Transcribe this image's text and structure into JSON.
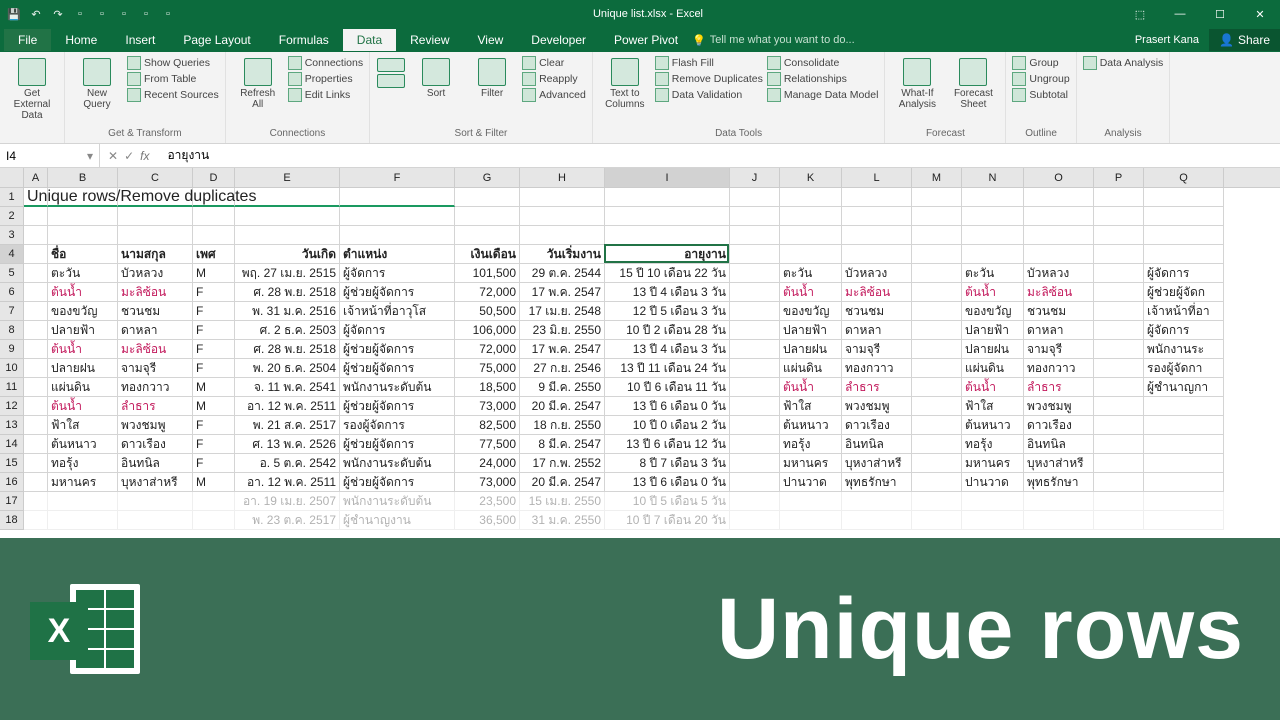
{
  "titlebar": {
    "title": "Unique list.xlsx - Excel"
  },
  "user": "Prasert Kana",
  "share": "Share",
  "tabs": {
    "file": "File",
    "home": "Home",
    "insert": "Insert",
    "pagelayout": "Page Layout",
    "formulas": "Formulas",
    "data": "Data",
    "review": "Review",
    "view": "View",
    "developer": "Developer",
    "powerpivot": "Power Pivot"
  },
  "tell": "Tell me what you want to do...",
  "ribbon": {
    "getexternal": "Get External\nData",
    "newquery": "New\nQuery",
    "refreshall": "Refresh\nAll",
    "sort": "Sort",
    "filter": "Filter",
    "texttocolumns": "Text to\nColumns",
    "whatif": "What-If\nAnalysis",
    "forecast": "Forecast\nSheet",
    "showqueries": "Show Queries",
    "fromtable": "From Table",
    "recentsources": "Recent Sources",
    "connections": "Connections",
    "properties": "Properties",
    "editlinks": "Edit Links",
    "clear": "Clear",
    "reapply": "Reapply",
    "advanced": "Advanced",
    "flashfill": "Flash Fill",
    "removedup": "Remove Duplicates",
    "datavalidation": "Data Validation",
    "consolidate": "Consolidate",
    "relationships": "Relationships",
    "managedata": "Manage Data Model",
    "groupbtn": "Group",
    "ungroup": "Ungroup",
    "subtotal": "Subtotal",
    "dataanalysis": "Data Analysis",
    "groups": {
      "gettransform": "Get & Transform",
      "connections": "Connections",
      "sortfilter": "Sort & Filter",
      "datatools": "Data Tools",
      "forecast": "Forecast",
      "outline": "Outline",
      "analysis": "Analysis"
    }
  },
  "namebox": "I4",
  "formula": "อายุงาน",
  "columns": [
    "A",
    "B",
    "C",
    "D",
    "E",
    "F",
    "G",
    "H",
    "I",
    "J",
    "K",
    "L",
    "M",
    "N",
    "O",
    "P",
    "Q"
  ],
  "title_cell": "Unique rows/Remove duplicates",
  "headers": {
    "name": "ชื่อ",
    "surname": "นามสกุล",
    "gender": "เพศ",
    "birth": "วันเกิด",
    "position": "ตำแหน่ง",
    "salary": "เงินเดือน",
    "startdate": "วันเริ่มงาน",
    "tenure": "อายุงาน"
  },
  "rows": [
    {
      "n": "ตะวัน",
      "s": "บัวหลวง",
      "g": "M",
      "b": "พฤ. 27 เม.ย. 2515",
      "p": "ผู้จัดการ",
      "sal": "101,500",
      "sd": "29 ต.ค. 2544",
      "t": "15 ปี 10 เดือน 22 วัน",
      "k": "ตะวัน",
      "l": "บัวหลวง",
      "nn": "ตะวัน",
      "oo": "บัวหลวง",
      "q": "ผู้จัดการ"
    },
    {
      "n": "ต้นน้ำ",
      "s": "มะลิซ้อน",
      "g": "F",
      "b": "ศ. 28 พ.ย. 2518",
      "p": "ผู้ช่วยผู้จัดการ",
      "sal": "72,000",
      "sd": "17 พ.ค. 2547",
      "t": "13 ปี 4 เดือน 3 วัน",
      "k": "ต้นน้ำ",
      "l": "มะลิซ้อน",
      "nn": "ต้นน้ำ",
      "oo": "มะลิซ้อน",
      "q": "ผู้ช่วยผู้จัดก",
      "pink": true,
      "kpink": true,
      "npink": true
    },
    {
      "n": "ของขวัญ",
      "s": "ชวนชม",
      "g": "F",
      "b": "พ. 31 ม.ค. 2516",
      "p": "เจ้าหน้าที่อาวุโส",
      "sal": "50,500",
      "sd": "17 เม.ย. 2548",
      "t": "12 ปี 5 เดือน 3 วัน",
      "k": "ของขวัญ",
      "l": "ชวนชม",
      "nn": "ของขวัญ",
      "oo": "ชวนชม",
      "q": "เจ้าหน้าที่อา"
    },
    {
      "n": "ปลายฟ้า",
      "s": "ดาหลา",
      "g": "F",
      "b": "ศ. 2 ธ.ค. 2503",
      "p": "ผู้จัดการ",
      "sal": "106,000",
      "sd": "23 มิ.ย. 2550",
      "t": "10 ปี 2 เดือน 28 วัน",
      "k": "ปลายฟ้า",
      "l": "ดาหลา",
      "nn": "ปลายฟ้า",
      "oo": "ดาหลา",
      "q": "ผู้จัดการ"
    },
    {
      "n": "ต้นน้ำ",
      "s": "มะลิซ้อน",
      "g": "F",
      "b": "ศ. 28 พ.ย. 2518",
      "p": "ผู้ช่วยผู้จัดการ",
      "sal": "72,000",
      "sd": "17 พ.ค. 2547",
      "t": "13 ปี 4 เดือน 3 วัน",
      "k": "ปลายฝน",
      "l": "จามจุรี",
      "nn": "ปลายฝน",
      "oo": "จามจุรี",
      "q": "พนักงานระ",
      "pink": true
    },
    {
      "n": "ปลายฝน",
      "s": "จามจุรี",
      "g": "F",
      "b": "พ. 20 ธ.ค. 2504",
      "p": "ผู้ช่วยผู้จัดการ",
      "sal": "75,000",
      "sd": "27 ก.ย. 2546",
      "t": "13 ปี 11 เดือน 24 วัน",
      "k": "แผ่นดิน",
      "l": "ทองกวาว",
      "nn": "แผ่นดิน",
      "oo": "ทองกวาว",
      "q": "รองผู้จัดกา"
    },
    {
      "n": "แผ่นดิน",
      "s": "ทองกวาว",
      "g": "M",
      "b": "จ. 11 พ.ค. 2541",
      "p": "พนักงานระดับต้น",
      "sal": "18,500",
      "sd": "9 มี.ค. 2550",
      "t": "10 ปี 6 เดือน 11 วัน",
      "k": "ต้นน้ำ",
      "l": "ลำธาร",
      "nn": "ต้นน้ำ",
      "oo": "ลำธาร",
      "q": "ผู้ชำนาญกา",
      "kpink": true,
      "npink": true
    },
    {
      "n": "ต้นน้ำ",
      "s": "ลำธาร",
      "g": "M",
      "b": "อา. 12 พ.ค. 2511",
      "p": "ผู้ช่วยผู้จัดการ",
      "sal": "73,000",
      "sd": "20 มี.ค. 2547",
      "t": "13 ปี 6 เดือน 0 วัน",
      "k": "ฟ้าใส",
      "l": "พวงชมพู",
      "nn": "ฟ้าใส",
      "oo": "พวงชมพู",
      "pink": true
    },
    {
      "n": "ฟ้าใส",
      "s": "พวงชมพู",
      "g": "F",
      "b": "พ. 21 ส.ค. 2517",
      "p": "รองผู้จัดการ",
      "sal": "82,500",
      "sd": "18 ก.ย. 2550",
      "t": "10 ปี 0 เดือน 2 วัน",
      "k": "ต้นหนาว",
      "l": "ดาวเรือง",
      "nn": "ต้นหนาว",
      "oo": "ดาวเรือง"
    },
    {
      "n": "ต้นหนาว",
      "s": "ดาวเรือง",
      "g": "F",
      "b": "ศ. 13 พ.ค. 2526",
      "p": "ผู้ช่วยผู้จัดการ",
      "sal": "77,500",
      "sd": "8 มี.ค. 2547",
      "t": "13 ปี 6 เดือน 12 วัน",
      "k": "ทอรุ้ง",
      "l": "อินทนิล",
      "nn": "ทอรุ้ง",
      "oo": "อินทนิล"
    },
    {
      "n": "ทอรุ้ง",
      "s": "อินทนิล",
      "g": "F",
      "b": "อ. 5 ต.ค. 2542",
      "p": "พนักงานระดับต้น",
      "sal": "24,000",
      "sd": "17 ก.พ. 2552",
      "t": "8 ปี 7 เดือน 3 วัน",
      "k": "มหานคร",
      "l": "บุหงาส่าหรี",
      "nn": "มหานคร",
      "oo": "บุหงาส่าหรี"
    },
    {
      "n": "มหานคร",
      "s": "บุหงาส่าหรี",
      "g": "M",
      "b": "อา. 12 พ.ค. 2511",
      "p": "ผู้ช่วยผู้จัดการ",
      "sal": "73,000",
      "sd": "20 มี.ค. 2547",
      "t": "13 ปี 6 เดือน 0 วัน",
      "k": "ปานวาด",
      "l": "พุทธรักษา",
      "nn": "ปานวาด",
      "oo": "พุทธรักษา"
    }
  ],
  "ghost_rows": [
    {
      "b": "อา. 19 เม.ย. 2507",
      "p": "พนักงานระดับต้น",
      "sal": "23,500",
      "sd": "15 เม.ย. 2550",
      "t": "10 ปี 5 เดือน 5 วัน"
    },
    {
      "b": "พ. 23 ต.ค. 2517",
      "p": "ผู้ชำนาญงาน",
      "sal": "36,500",
      "sd": "31 ม.ค. 2550",
      "t": "10 ปี 7 เดือน 20 วัน"
    }
  ],
  "overlay_text": "Unique rows",
  "overlay_badge": "X"
}
